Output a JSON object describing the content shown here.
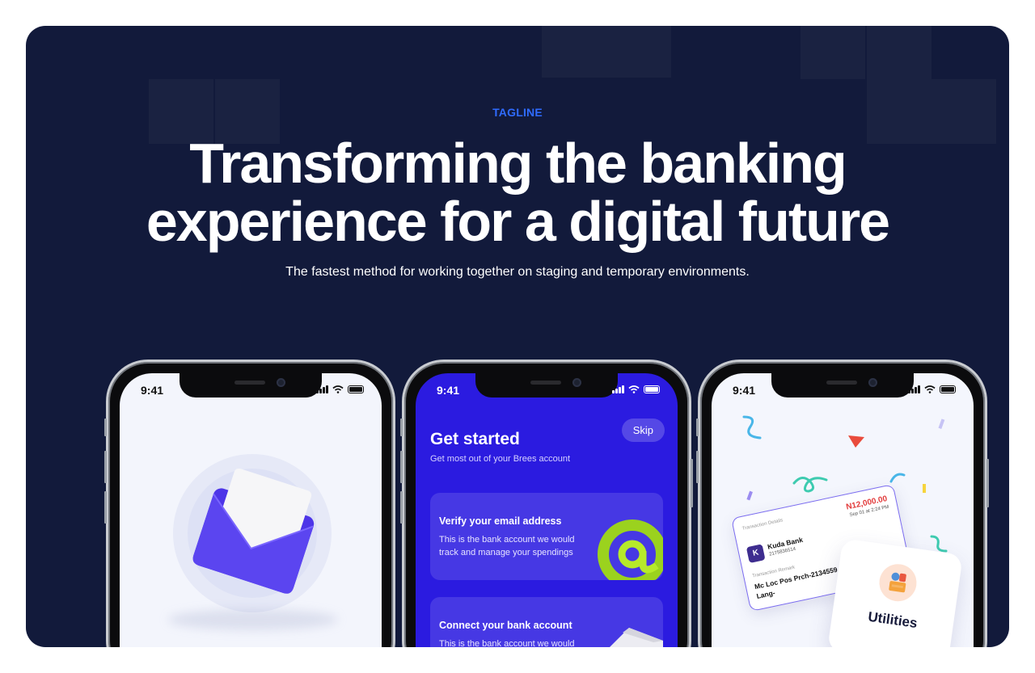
{
  "hero": {
    "tagline": "TAGLINE",
    "headline_line1": "Transforming the banking",
    "headline_line2": "experience for a digital future",
    "subtitle": "The fastest method for working together on staging and temporary environments.",
    "colors": {
      "background": "#121a3b",
      "accent": "#2f6bff",
      "text": "#ffffff"
    }
  },
  "phones": [
    {
      "time": "9:41",
      "screen": "email-envelope",
      "colors": {
        "background": "#f3f5fc",
        "envelope": "#4d35e8"
      }
    },
    {
      "time": "9:41",
      "skip_label": "Skip",
      "title": "Get started",
      "subtitle": "Get most out of your Brees account",
      "cards": [
        {
          "title": "Verify your email address",
          "text": "This is the bank account we would track and manage your spendings",
          "icon": "at-sign-icon"
        },
        {
          "title": "Connect your bank account",
          "text": "This is the bank account we would",
          "icon": "bank-icon"
        }
      ],
      "colors": {
        "background": "#2b1be0"
      }
    },
    {
      "time": "9:41",
      "transaction": {
        "details_label": "Transaction Details",
        "amount": "N12,000.00",
        "date": "Sep 01 at 2:24 PM",
        "bank_name": "Kuda Bank",
        "account_number": "2175836514",
        "bank_logo_letter": "K",
        "remark_label": "Transaction Remark",
        "remark": "Mc Loc Pos Prch-2134559 Electronic T La Lang-"
      },
      "utilities_label": "Utilities",
      "colors": {
        "background": "#f4f6fd",
        "amount": "#e23a3a"
      }
    }
  ]
}
